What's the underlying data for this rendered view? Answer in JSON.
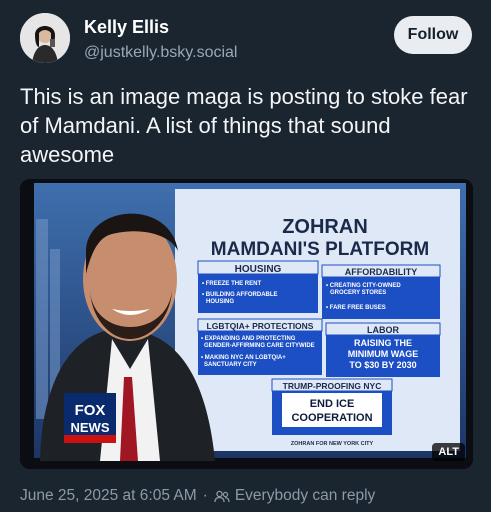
{
  "post": {
    "author_name": "Kelly Ellis",
    "handle": "@justkelly.bsky.social",
    "follow_label": "Follow",
    "text": "This is an image maga is posting to stoke fear of Mamdani. A list of things that sound awesome",
    "timestamp": "June 25, 2025 at 6:05 AM",
    "reply_setting": "Everybody can reply",
    "alt_badge": "ALT"
  },
  "tv_graphic": {
    "title_line1": "ZOHRAN",
    "title_line2": "MAMDANI'S PLATFORM",
    "housing": {
      "header": "HOUSING",
      "items": [
        "• FREEZE THE RENT",
        "• BUILDING AFFORDABLE",
        "HOUSING"
      ]
    },
    "affordability": {
      "header": "AFFORDABILITY",
      "items": [
        "• CREATING CITY-OWNED",
        "GROCERY STORES",
        "• FARE FREE BUSES"
      ]
    },
    "lgbtqia": {
      "header": "LGBTQIA+ PROTECTIONS",
      "items": [
        "• EXPANDING AND PROTECTING",
        "GENDER-AFFIRMING CARE CITYWIDE",
        "• MAKING NYC AN LGBTQIA+",
        "SANCTUARY CITY"
      ]
    },
    "labor": {
      "header": "LABOR",
      "items": [
        "RAISING THE",
        "MINIMUM WAGE",
        "TO $30 BY 2030"
      ]
    },
    "trump": {
      "header": "TRUMP-PROOFING NYC",
      "items": [
        "END ICE",
        "COOPERATION"
      ]
    },
    "source": "ZOHRAN FOR NEW YORK CITY",
    "network_logo": [
      "FOX",
      "NEWS"
    ]
  },
  "colors": {
    "background": "#1b2530",
    "graphic_blue": "#1d4fc4",
    "graphic_light": "#dfe8f6"
  }
}
